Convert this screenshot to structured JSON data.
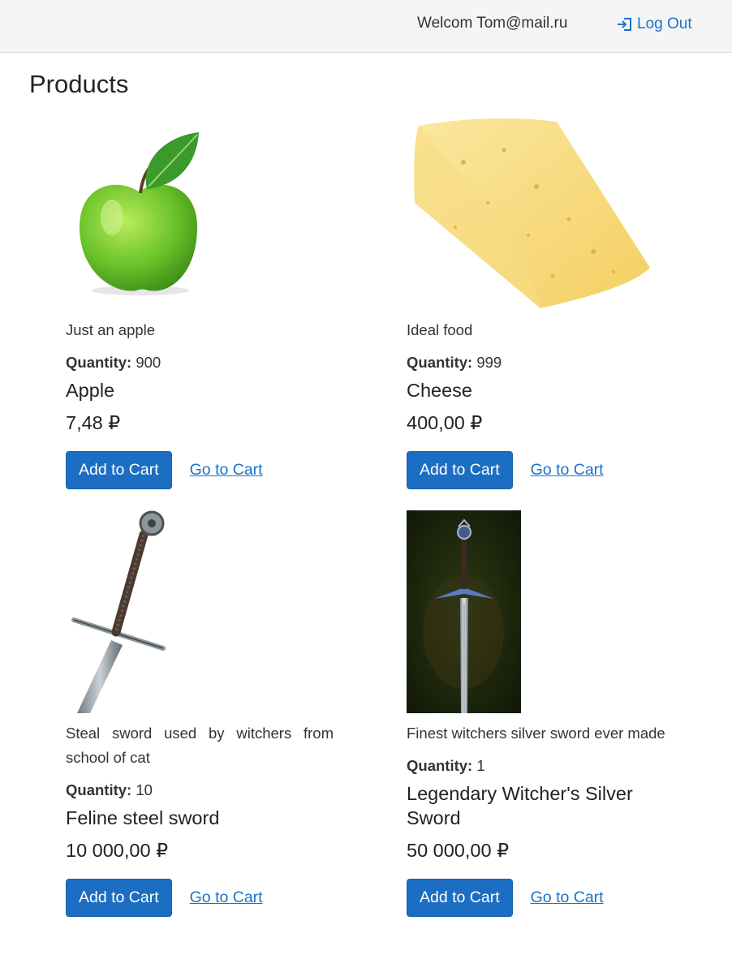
{
  "header": {
    "welcome_text": "Welcom Tom@mail.ru",
    "logout_label": "Log Out",
    "logout_icon": "sign-out-icon"
  },
  "page": {
    "title": "Products"
  },
  "labels": {
    "quantity": "Quantity:",
    "add_to_cart": "Add to Cart",
    "go_to_cart": "Go to Cart"
  },
  "products": [
    {
      "description": "Just an apple",
      "quantity": "900",
      "name": "Apple",
      "price": "7,48 ₽",
      "image": "apple-image"
    },
    {
      "description": "Ideal food",
      "quantity": "999",
      "name": "Cheese",
      "price": "400,00 ₽",
      "image": "cheese-image"
    },
    {
      "description": "Steal sword used by witchers from school of cat",
      "quantity": "10",
      "name": "Feline steel sword",
      "price": "10 000,00 ₽",
      "image": "steel-sword-image"
    },
    {
      "description": "Finest witchers silver sword ever made",
      "quantity": "1",
      "name": "Legendary Witcher's Silver Sword",
      "price": "50 000,00 ₽",
      "image": "silver-sword-image"
    }
  ],
  "colors": {
    "primary_button": "#1b6ec2",
    "link": "#1b73c9",
    "navbar": "#f5f5f5"
  }
}
